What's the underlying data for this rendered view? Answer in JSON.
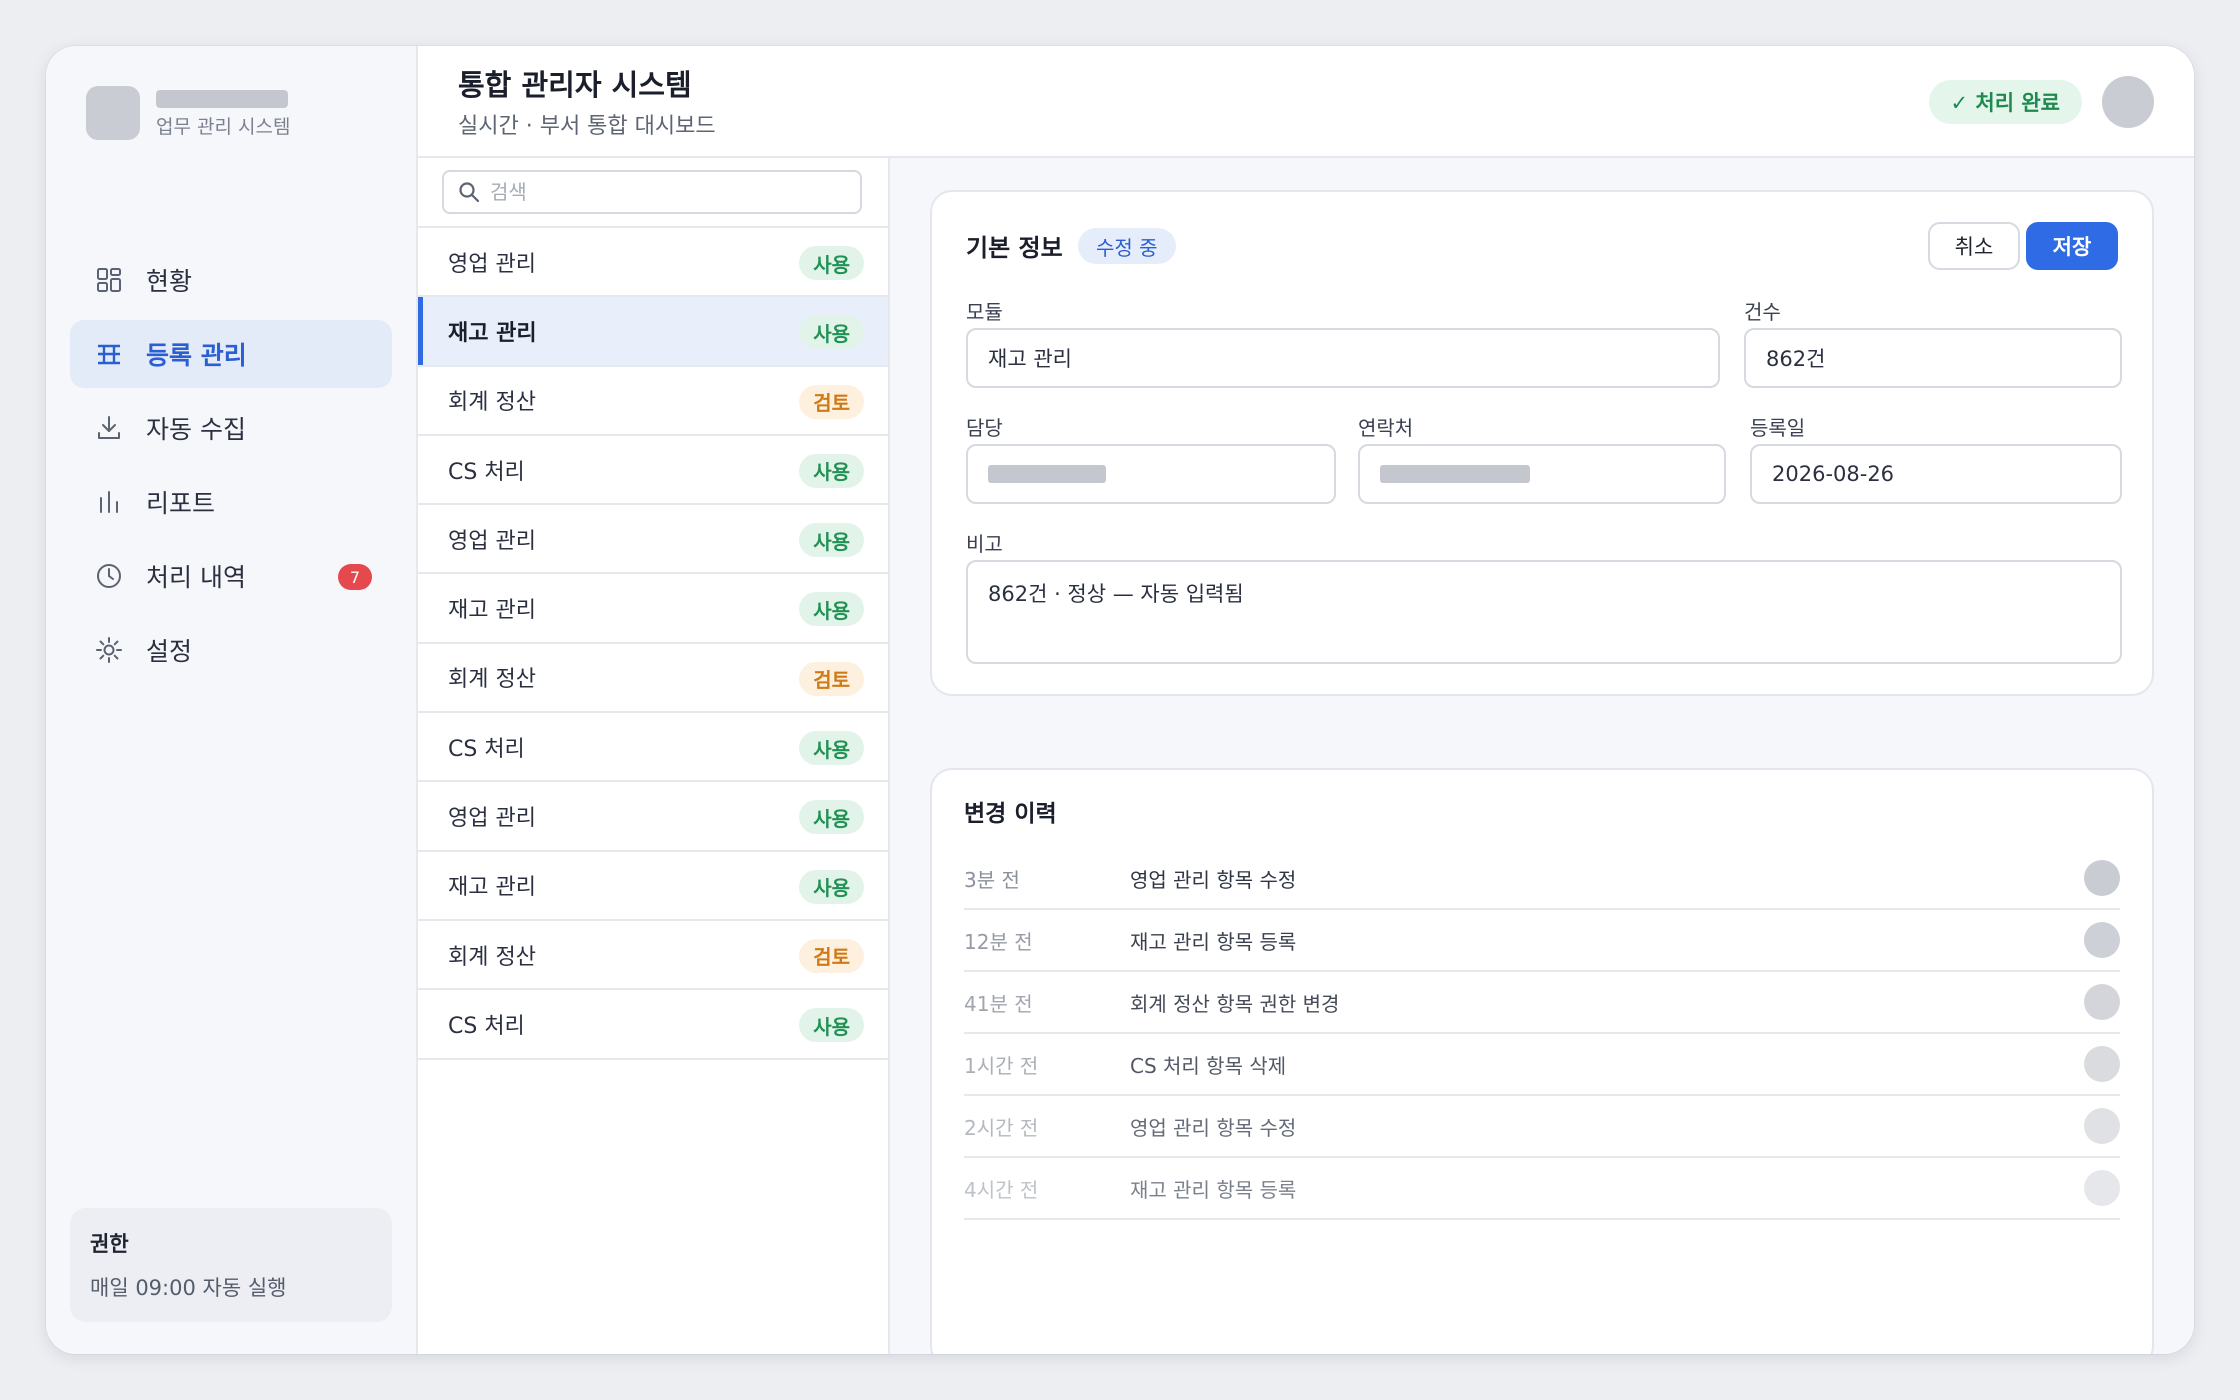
{
  "sidebar": {
    "brand_sub": "업무 관리 시스템",
    "items": [
      {
        "label": "현황",
        "icon": "grid-icon"
      },
      {
        "label": "등록 관리",
        "icon": "table-icon"
      },
      {
        "label": "자동 수집",
        "icon": "download-icon"
      },
      {
        "label": "리포트",
        "icon": "bar-chart-icon"
      },
      {
        "label": "처리 내역",
        "icon": "clock-icon",
        "badge": "7"
      },
      {
        "label": "설정",
        "icon": "gear-icon"
      }
    ],
    "active_index": 1,
    "permission": {
      "title": "권한",
      "desc": "매일 09:00 자동 실행"
    }
  },
  "header": {
    "title": "통합 관리자 시스템",
    "subtitle": "실시간 · 부서 통합 대시보드",
    "status": "✓ 처리 완료"
  },
  "list": {
    "search_placeholder": "검색",
    "items": [
      {
        "label": "영업 관리",
        "badge": "사용",
        "status": "use"
      },
      {
        "label": "재고 관리",
        "badge": "사용",
        "status": "use"
      },
      {
        "label": "회계 정산",
        "badge": "검토",
        "status": "review"
      },
      {
        "label": "CS 처리",
        "badge": "사용",
        "status": "use"
      },
      {
        "label": "영업 관리",
        "badge": "사용",
        "status": "use"
      },
      {
        "label": "재고 관리",
        "badge": "사용",
        "status": "use"
      },
      {
        "label": "회계 정산",
        "badge": "검토",
        "status": "review"
      },
      {
        "label": "CS 처리",
        "badge": "사용",
        "status": "use"
      },
      {
        "label": "영업 관리",
        "badge": "사용",
        "status": "use"
      },
      {
        "label": "재고 관리",
        "badge": "사용",
        "status": "use"
      },
      {
        "label": "회계 정산",
        "badge": "검토",
        "status": "review"
      },
      {
        "label": "CS 처리",
        "badge": "사용",
        "status": "use"
      }
    ],
    "selected_index": 1
  },
  "form": {
    "title": "기본 정보",
    "mode": "수정 중",
    "cancel_label": "취소",
    "save_label": "저장",
    "module_label": "모듈",
    "module_value": "재고 관리",
    "count_label": "건수",
    "count_value": "862건",
    "owner_label": "담당",
    "contact_label": "연락처",
    "date_label": "등록일",
    "date_value": "2026-08-26",
    "note_label": "비고",
    "note_value": "862건 · 정상 — 자동 입력됨"
  },
  "history": {
    "title": "변경 이력",
    "items": [
      {
        "time": "3분 전",
        "text": "영업 관리 항목 수정"
      },
      {
        "time": "12분 전",
        "text": "재고 관리 항목 등록"
      },
      {
        "time": "41분 전",
        "text": "회계 정산 항목 권한 변경"
      },
      {
        "time": "1시간 전",
        "text": "CS 처리 항목 삭제"
      },
      {
        "time": "2시간 전",
        "text": "영업 관리 항목 수정"
      },
      {
        "time": "4시간 전",
        "text": "재고 관리 항목 등록"
      }
    ]
  },
  "colors": {
    "accent": "#2f6be4",
    "success": "#219155",
    "warning": "#d07a16",
    "danger": "#e5484d"
  }
}
